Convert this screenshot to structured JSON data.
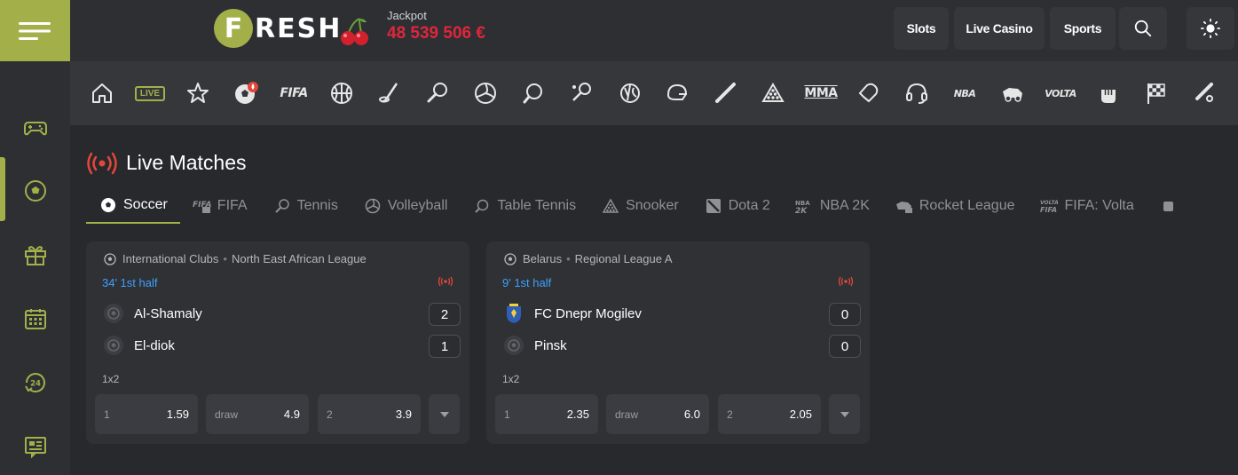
{
  "header": {
    "logo_letter": "F",
    "logo_rest": "RESH",
    "jackpot_label": "Jackpot",
    "jackpot_value": "48 539 506 €",
    "buttons": {
      "slots": "Slots",
      "live_casino": "Live Casino",
      "sports": "Sports"
    }
  },
  "sportnav": {
    "live_badge": "LIVE",
    "fifa_label": "FIFA",
    "mma_label": "MMA",
    "nba_label": "NBA",
    "volta_label": "VOLTA"
  },
  "section": {
    "title": "Live Matches"
  },
  "tabs": [
    {
      "label": "Soccer"
    },
    {
      "label": "FIFA"
    },
    {
      "label": "Tennis"
    },
    {
      "label": "Volleyball"
    },
    {
      "label": "Table Tennis"
    },
    {
      "label": "Snooker"
    },
    {
      "label": "Dota 2"
    },
    {
      "label": "NBA 2K"
    },
    {
      "label": "Rocket League"
    },
    {
      "label": "FIFA: Volta"
    }
  ],
  "matches": [
    {
      "country": "International Clubs",
      "league": "North East African League",
      "time": "34' 1st half",
      "home": {
        "name": "Al-Shamaly",
        "score": "2"
      },
      "away": {
        "name": "El-diok",
        "score": "1"
      },
      "market": "1x2",
      "odds": [
        {
          "label": "1",
          "value": "1.59"
        },
        {
          "label": "draw",
          "value": "4.9"
        },
        {
          "label": "2",
          "value": "3.9"
        }
      ]
    },
    {
      "country": "Belarus",
      "league": "Regional League A",
      "time": "9' 1st half",
      "home": {
        "name": "FC Dnepr Mogilev",
        "score": "0"
      },
      "away": {
        "name": "Pinsk",
        "score": "0"
      },
      "market": "1x2",
      "odds": [
        {
          "label": "1",
          "value": "2.35"
        },
        {
          "label": "draw",
          "value": "6.0"
        },
        {
          "label": "2",
          "value": "2.05"
        }
      ]
    }
  ],
  "colors": {
    "accent": "#a3b04a",
    "jackpot": "#e0263b",
    "live_red": "#e2473b",
    "time_blue": "#3ea0ff"
  }
}
